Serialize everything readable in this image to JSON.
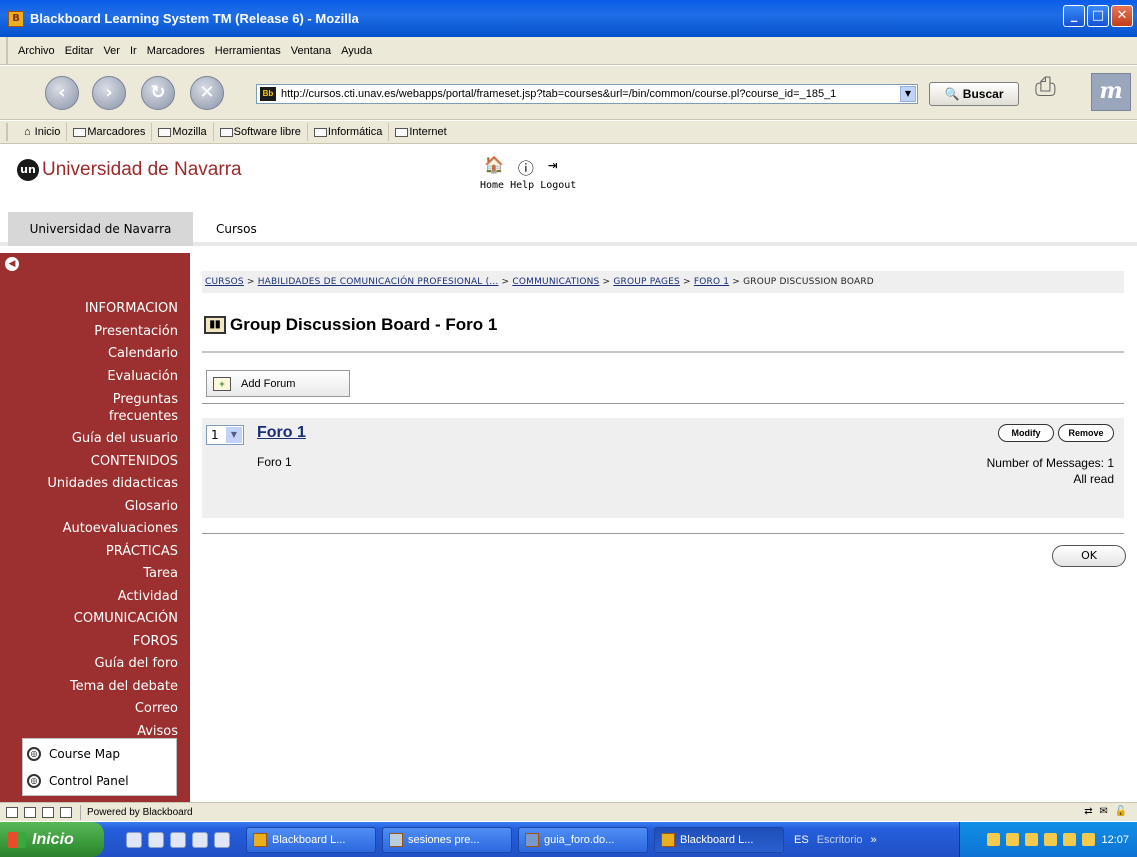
{
  "window": {
    "title": "Blackboard Learning System TM (Release 6) - Mozilla"
  },
  "menu": [
    "Archivo",
    "Editar",
    "Ver",
    "Ir",
    "Marcadores",
    "Herramientas",
    "Ventana",
    "Ayuda"
  ],
  "nav": {
    "url": "http://cursos.cti.unav.es/webapps/portal/frameset.jsp?tab=courses&url=/bin/common/course.pl?course_id=_185_1",
    "search_label": "Buscar"
  },
  "bookmarks": [
    "Inicio",
    "Marcadores",
    "Mozilla",
    "Software libre",
    "Informática",
    "Internet"
  ],
  "header": {
    "logo_mark": "un",
    "logo_text": "Universidad de Navarra",
    "home": "Home",
    "help": "Help",
    "logout": "Logout"
  },
  "tabs": {
    "un": "Universidad de Navarra",
    "cursos": "Cursos"
  },
  "sidebar": {
    "items": [
      {
        "label": "INFORMACION",
        "section": true
      },
      {
        "label": "Presentación"
      },
      {
        "label": "Calendario"
      },
      {
        "label": "Evaluación"
      },
      {
        "label": "Preguntas frecuentes",
        "two": true
      },
      {
        "label": "Guía del usuario"
      },
      {
        "label": "CONTENIDOS",
        "section": true
      },
      {
        "label": "Unidades didacticas"
      },
      {
        "label": "Glosario"
      },
      {
        "label": "Autoevaluaciones"
      },
      {
        "label": "PRÁCTICAS",
        "section": true
      },
      {
        "label": "Tarea"
      },
      {
        "label": "Actividad"
      },
      {
        "label": "COMUNICACIÓN",
        "section": true
      },
      {
        "label": "FOROS"
      },
      {
        "label": "Guía del foro"
      },
      {
        "label": "Tema del debate"
      },
      {
        "label": "Correo"
      },
      {
        "label": "Avisos"
      }
    ],
    "course_map": "Course Map",
    "control_panel": "Control Panel"
  },
  "breadcrumb": {
    "links": [
      "CURSOS",
      "HABILIDADES DE COMUNICACIÓN PROFESIONAL (...",
      "COMMUNICATIONS",
      "GROUP PAGES",
      "FORO 1"
    ],
    "current": "GROUP DISCUSSION BOARD"
  },
  "page": {
    "title": "Group Discussion Board - Foro 1",
    "add_forum": "Add Forum",
    "forum_order": "1",
    "forum_name": "Foro 1",
    "forum_desc": "Foro 1",
    "modify": "Modify",
    "remove": "Remove",
    "num_messages": "Number of Messages: 1",
    "all_read": "All read",
    "ok": "OK"
  },
  "status": {
    "text": "Powered by Blackboard"
  },
  "taskbar": {
    "start": "Inicio",
    "tasks": [
      "Blackboard L...",
      "sesiones pre...",
      "guia_foro.do...",
      "Blackboard L..."
    ],
    "lang": "ES",
    "desktop": "Escritorio",
    "time": "12:07"
  }
}
